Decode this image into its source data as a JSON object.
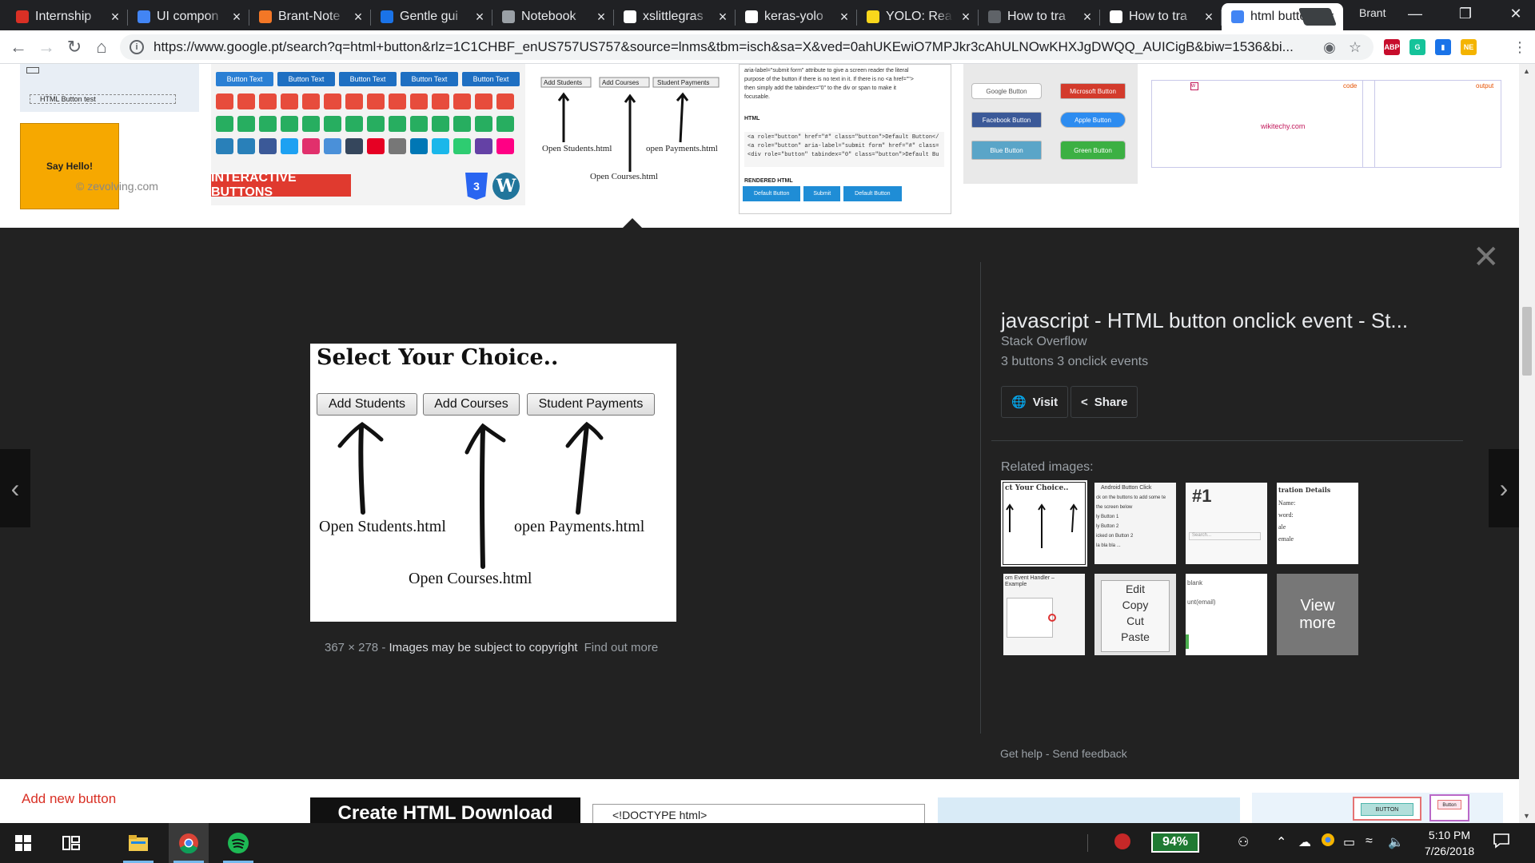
{
  "browser": {
    "tabs": [
      {
        "label": "Internship",
        "favicon": "gmail-icon",
        "color": "#d93025"
      },
      {
        "label": "UI compon",
        "favicon": "docs-icon",
        "color": "#4285f4"
      },
      {
        "label": "Brant-Note",
        "favicon": "jupyter-icon",
        "color": "#f37726"
      },
      {
        "label": "Gentle gui",
        "favicon": "blog-icon",
        "color": "#1a73e8"
      },
      {
        "label": "Notebook",
        "favicon": "document-icon",
        "color": "#9aa0a6"
      },
      {
        "label": "xslittlegras",
        "favicon": "github-icon",
        "color": "#ffffff"
      },
      {
        "label": "keras-yolo",
        "favicon": "github-icon",
        "color": "#ffffff"
      },
      {
        "label": "YOLO: Real",
        "favicon": "yolo-icon",
        "color": "#f9d71c"
      },
      {
        "label": "How to tra",
        "favicon": "blank-icon",
        "color": "#5f6368"
      },
      {
        "label": "How to tra",
        "favicon": "medium-icon",
        "color": "#ffffff"
      },
      {
        "label": "html butto",
        "favicon": "google-icon",
        "color": "#4285f4"
      }
    ],
    "profile_name": "Brant",
    "url": "https://www.google.pt/search?q=html+button&rlz=1C1CHBF_enUS757US757&source=lnms&tbm=isch&sa=X&ved=0ahUKEwiO7MPJkr3cAhULNOwKHXJgDWQQ_AUICigB&biw=1536&bi...",
    "extensions": [
      {
        "name": "adblock-icon",
        "text": "ABP",
        "color": "#c70d2c"
      },
      {
        "name": "grammarly-icon",
        "text": "G",
        "color": "#15c39a"
      },
      {
        "name": "bookmark-ext-icon",
        "text": "▮",
        "color": "#1a73e8"
      },
      {
        "name": "notes-ext-icon",
        "text": "NE",
        "color": "#f4b400"
      }
    ]
  },
  "top_thumbs": {
    "checkbox_label": "HTML Button test",
    "say_hello": "Say Hello!",
    "zevolving": "© zevolving.com",
    "interactive_buttons": "INTERACTIVE BUTTONS",
    "button_text": "Button Text",
    "mini_buttons": [
      "Add Students",
      "Add Courses",
      "Student Payments"
    ],
    "mini_labels": [
      "Open Students.html",
      "open Payments.html",
      "Open Courses.html"
    ],
    "code_snippet": [
      "aria-label=\"submit form\" attribute to give a screen reader the literal",
      "purpose of the button if there is no text in it. If there is no <a href=\"\">",
      "then simply add the tabindex=\"0\" to the div or span to make it",
      "focusable."
    ],
    "code_html_label": "HTML",
    "code_lines": [
      "<a role=\"button\" href=\"#\" class=\"button\">Default Button</",
      "<a role=\"button\" aria-label=\"submit form\" href=\"#\" class=",
      "<div role=\"button\" tabindex=\"0\" class=\"button\">Default Bu"
    ],
    "rendered_html_label": "RENDERED HTML",
    "rendered_buttons": [
      "Default Button",
      "Submit",
      "Default Button"
    ],
    "styled_buttons": [
      "Google Button",
      "Microsoft Button",
      "Facebook Button",
      "Apple Button",
      "Blue Button",
      "Green Button"
    ],
    "wikitechy": "wikitechy.com",
    "wk_code": "code",
    "wk_output": "output"
  },
  "preview": {
    "heading": "Select Your Choice..",
    "buttons": [
      "Add Students",
      "Add Courses",
      "Student Payments"
    ],
    "labels": {
      "students": "Open Students.html",
      "payments": "open Payments.html",
      "courses": "Open Courses.html"
    },
    "dimensions": "367 × 278",
    "separator": "-",
    "copyright": "Images may be subject to copyright",
    "find_out_more": "Find out more"
  },
  "side_panel": {
    "title": "javascript - HTML button onclick event - St...",
    "site": "Stack Overflow",
    "description": "3 buttons 3 onclick events",
    "visit_label": "Visit",
    "share_label": "Share",
    "related_label": "Related images:",
    "related": {
      "r1_heading": "ct Your Choice..",
      "r2_heading": "Android Button Click",
      "r2_lines": [
        "ck on the buttons to add some te",
        "the screen below",
        "ly Button 1",
        "ly Button 2",
        "icked on Button 2",
        "la bla bla ..."
      ],
      "r3_heading": "#1",
      "r3_search": "Search...",
      "r4_heading": "tration Details",
      "r4_fields": [
        "Name:",
        "word:",
        "ale",
        "emale"
      ],
      "r5_lines": [
        "om Event Handler –",
        "Example"
      ],
      "r6_menu": [
        "Edit",
        "Copy",
        "Cut",
        "Paste"
      ],
      "r7_lines": [
        "blank",
        "unt(email)"
      ],
      "view_more": "View more"
    },
    "footer_help": "Get help",
    "footer_sep": "-",
    "footer_feedback": "Send feedback"
  },
  "bottom_row": {
    "add_new_button": "Add new button",
    "create_download": "Create HTML Download",
    "doctype": "<!DOCTYPE html>",
    "button_thumb_labels": [
      "BUTTON",
      "Button"
    ]
  },
  "taskbar": {
    "battery": "94%",
    "time": "5:10 PM",
    "date": "7/26/2018"
  }
}
